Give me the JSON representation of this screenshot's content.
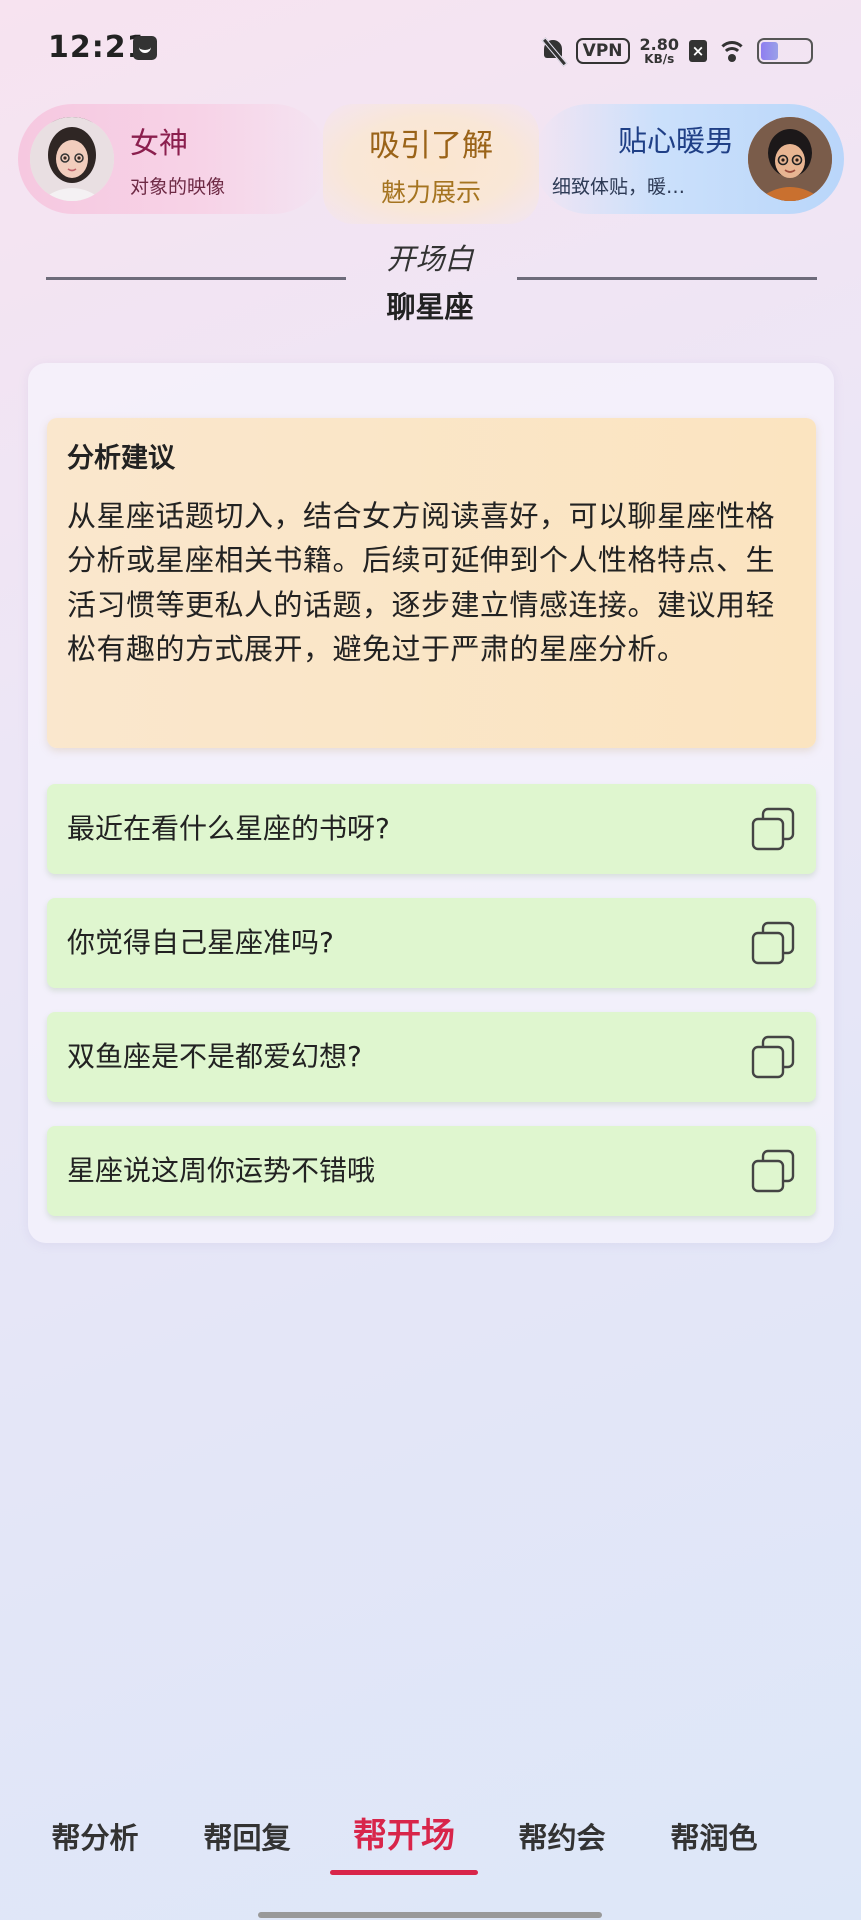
{
  "status_bar": {
    "time": "12:21",
    "vpn": "VPN",
    "speed_value": "2.80",
    "speed_unit": "KB/s",
    "battery_level": 0.35
  },
  "personas": {
    "left": {
      "name": "女神",
      "subtitle": "对象的映像"
    },
    "center": {
      "title": "吸引了解",
      "subtitle": "魅力展示"
    },
    "right": {
      "name": "贴心暖男",
      "subtitle": "细致体贴，暖…"
    }
  },
  "section": {
    "label": "开场白",
    "topic": "聊星座"
  },
  "analysis": {
    "title": "分析建议",
    "body": "从星座话题切入，结合女方阅读喜好，可以聊星座性格分析或星座相关书籍。后续可延伸到个人性格特点、生活习惯等更私人的话题，逐步建立情感连接。建议用轻松有趣的方式展开，避免过于严肃的星座分析。"
  },
  "openers": [
    {
      "text": "最近在看什么星座的书呀?"
    },
    {
      "text": "你觉得自己星座准吗?"
    },
    {
      "text": "双鱼座是不是都爱幻想?"
    },
    {
      "text": "星座说这周你运势不错哦"
    }
  ],
  "tabs": [
    {
      "label": "帮分析"
    },
    {
      "label": "帮回复"
    },
    {
      "label": "帮开场"
    },
    {
      "label": "帮约会"
    },
    {
      "label": "帮润色"
    }
  ],
  "active_tab": "帮开场",
  "colors": {
    "accent": "#d8254a",
    "analysis_bg": "#fbe6c8",
    "option_bg": "#dff6cf"
  }
}
